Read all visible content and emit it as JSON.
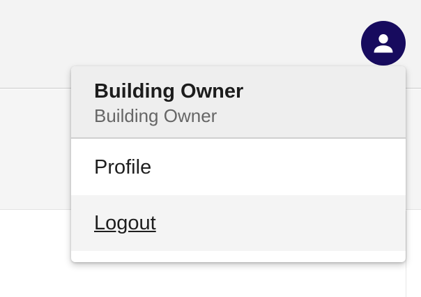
{
  "theme": {
    "accent": "#170b5e"
  },
  "header": {
    "avatar_icon": "account-person-icon"
  },
  "user_menu": {
    "name": "Building Owner",
    "role": "Building Owner",
    "items": [
      {
        "label": "Profile"
      },
      {
        "label": "Logout"
      }
    ]
  }
}
